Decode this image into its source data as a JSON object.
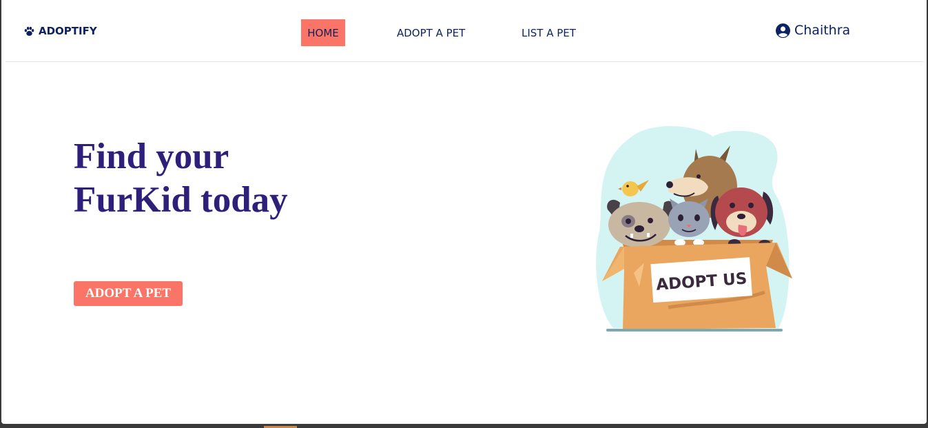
{
  "nav": {
    "brand": "ADOPTIFY",
    "links": [
      {
        "label": "HOME",
        "active": true
      },
      {
        "label": "ADOPT A PET",
        "active": false
      },
      {
        "label": "LIST A PET",
        "active": false
      }
    ],
    "user_name": "Chaithra"
  },
  "hero": {
    "title_line1": "Find your",
    "title_line2": "FurKid today",
    "cta_label": "ADOPT A PET",
    "box_sign": "ADOPT US"
  },
  "icons": {
    "brand_icon": "paw-icon",
    "user_icon": "user-circle-icon"
  },
  "colors": {
    "accent": "#fa7468",
    "nav_text": "#0d2260",
    "heading": "#2e1f7a",
    "blob": "#d4f4f4",
    "box": "#eaa65e"
  }
}
